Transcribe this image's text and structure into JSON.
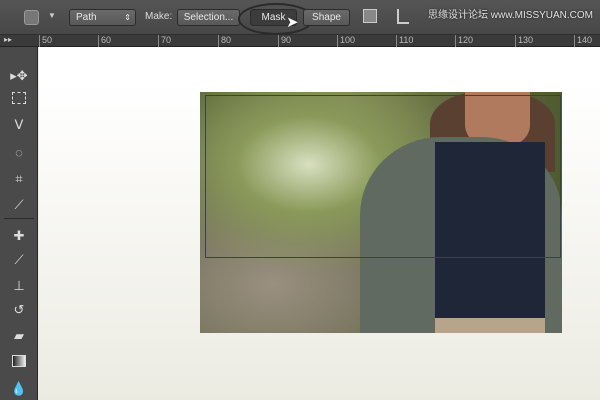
{
  "options_bar": {
    "mode_value": "Path",
    "make_label": "Make:",
    "selection_button": "Selection...",
    "mask_button": "Mask",
    "shape_button": "Shape"
  },
  "ruler": {
    "ticks": [
      "50",
      "60",
      "70",
      "80",
      "90",
      "100",
      "110",
      "120",
      "130",
      "140"
    ]
  },
  "tools": [
    "move-tool",
    "marquee-tool",
    "lasso-tool",
    "quick-selection-tool",
    "crop-tool",
    "eyedropper-tool",
    "healing-brush-tool",
    "brush-tool",
    "clone-stamp-tool",
    "history-brush-tool",
    "eraser-tool",
    "gradient-tool",
    "blur-tool"
  ],
  "watermark": "思缘设计论坛 www.MISSYUAN.COM"
}
